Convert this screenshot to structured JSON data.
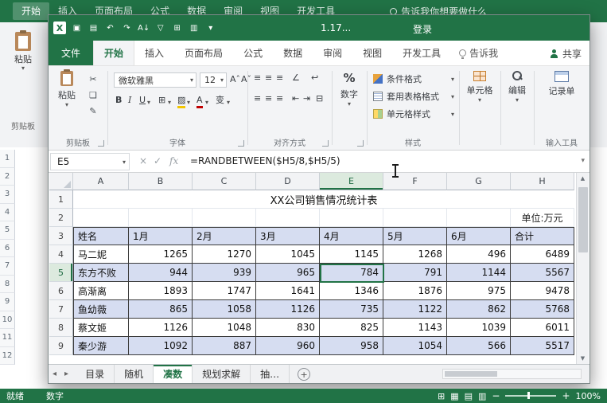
{
  "colors": {
    "excel_green": "#217346",
    "band_fill": "#d6ddf1",
    "table_border": "#3b3b3b"
  },
  "background_window": {
    "ribbon_tabs": [
      "开始",
      "插入",
      "页面布局",
      "公式",
      "数据",
      "审阅",
      "视图",
      "开发工具"
    ],
    "tell_me": "告诉我你想要做什么",
    "paste_label": "粘贴",
    "clipboard_group_label": "剪贴板",
    "row_numbers": [
      "1",
      "2",
      "3",
      "4",
      "5",
      "6",
      "7",
      "8",
      "9",
      "10",
      "11",
      "12"
    ],
    "status_bar": {
      "ready": "就绪",
      "mode": "数字",
      "zoom_level": "100%"
    }
  },
  "window": {
    "title_bar": {
      "title": "1.17...",
      "sign_in": "登录",
      "quick_access": [
        {
          "name": "excel-logo-icon",
          "glyph": "X"
        },
        {
          "name": "save-icon",
          "glyph": "▣"
        },
        {
          "name": "print-icon",
          "glyph": "▤"
        },
        {
          "name": "undo-icon",
          "glyph": "↶"
        },
        {
          "name": "redo-icon",
          "glyph": "↷"
        },
        {
          "name": "sort-ascending-icon",
          "glyph": "A↓"
        },
        {
          "name": "filter-icon",
          "glyph": "▽"
        },
        {
          "name": "freeze-panes-icon",
          "glyph": "⊞"
        },
        {
          "name": "chart-icon",
          "glyph": "▥"
        },
        {
          "name": "customize-qat-icon",
          "glyph": "▾"
        }
      ]
    },
    "file_tab": "文件",
    "ribbon_tabs": [
      {
        "label": "开始",
        "active": true
      },
      {
        "label": "插入",
        "active": false
      },
      {
        "label": "页面布局",
        "active": false
      },
      {
        "label": "公式",
        "active": false
      },
      {
        "label": "数据",
        "active": false
      },
      {
        "label": "审阅",
        "active": false
      },
      {
        "label": "视图",
        "active": false
      },
      {
        "label": "开发工具",
        "active": false
      }
    ],
    "tell_me": "告诉我",
    "share": "共享",
    "ribbon": {
      "paste_label": "粘贴",
      "clipboard_group_label": "剪贴板",
      "font_name": "微软雅黑",
      "font_size": "12",
      "font_group_label": "字体",
      "alignment_group_label": "对齐方式",
      "number_button_label": "数字",
      "style_buttons": [
        "条件格式",
        "套用表格格式",
        "单元格样式"
      ],
      "style_group_label": "样式",
      "cells_button_label": "单元格",
      "edit_button_label": "编辑",
      "record_button_label": "记录单",
      "input_tools_group_label": "输入工具"
    },
    "formula_bar": {
      "name_box": "E5",
      "fx_label": "fx",
      "formula": "=RANDBETWEEN($H5/8,$H5/5)"
    },
    "sheet": {
      "columns": [
        "A",
        "B",
        "C",
        "D",
        "E",
        "F",
        "G",
        "H"
      ],
      "row_numbers": [
        "1",
        "2",
        "3",
        "4",
        "5",
        "6",
        "7",
        "8",
        "9"
      ],
      "title": "XX公司销售情况统计表",
      "unit_note": "单位:万元",
      "header_row": [
        "姓名",
        "1月",
        "2月",
        "3月",
        "4月",
        "5月",
        "6月",
        "合计"
      ],
      "data_rows": [
        [
          "马二妮",
          "1265",
          "1270",
          "1045",
          "1145",
          "1268",
          "496",
          "6489"
        ],
        [
          "东方不败",
          "944",
          "939",
          "965",
          "784",
          "791",
          "1144",
          "5567"
        ],
        [
          "高渐离",
          "1893",
          "1747",
          "1641",
          "1346",
          "1876",
          "975",
          "9478"
        ],
        [
          "鱼幼薇",
          "865",
          "1058",
          "1126",
          "735",
          "1122",
          "862",
          "5768"
        ],
        [
          "蔡文姬",
          "1126",
          "1048",
          "830",
          "825",
          "1143",
          "1039",
          "6011"
        ],
        [
          "秦少游",
          "1092",
          "887",
          "960",
          "958",
          "1054",
          "566",
          "5517"
        ]
      ],
      "selected_cell": "E5"
    },
    "sheet_tabs": [
      {
        "label": "目录",
        "active": false
      },
      {
        "label": "随机",
        "active": false
      },
      {
        "label": "凑数",
        "active": true
      },
      {
        "label": "规划求解",
        "active": false
      },
      {
        "label": "抽…",
        "active": false
      }
    ]
  },
  "icons": {
    "cut": "✂",
    "copy": "❏",
    "format_painter": "✎",
    "bold": "B",
    "italic": "I",
    "underline": "U",
    "borders": "⊞",
    "fill_color": "▨",
    "font_color": "A",
    "phonetic": "变",
    "align": "≡",
    "orientation": "∠",
    "wrap_text": "↩",
    "indent_decrease": "⇤",
    "indent_increase": "⇥",
    "merge_center": "⊟",
    "increase_font": "Aˆ",
    "decrease_font": "Aˇ",
    "percent": "%",
    "cancel": "×",
    "enter": "✓",
    "dropdown": "▾",
    "sheet_nav_left": "◂",
    "sheet_nav_right": "▸",
    "add_sheet": "+",
    "scroll_up": "▲",
    "scroll_down": "▼",
    "view_normal": "▦",
    "view_layout": "▤",
    "view_break": "▥",
    "cell_grid": "⊞",
    "zoom_out": "−",
    "zoom_in": "+"
  }
}
